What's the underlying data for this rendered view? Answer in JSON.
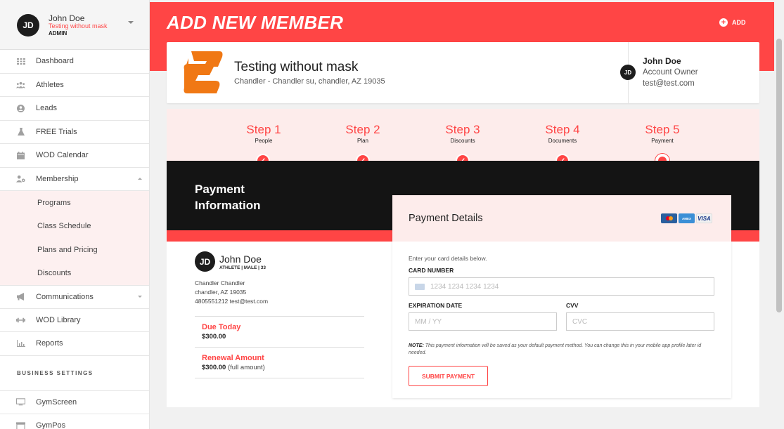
{
  "user": {
    "initials": "JD",
    "name": "John Doe",
    "subtitle": "Testing without mask",
    "role": "ADMIN"
  },
  "sidebar": {
    "items": [
      {
        "label": "Dashboard",
        "icon": "grid-icon"
      },
      {
        "label": "Athletes",
        "icon": "users-icon"
      },
      {
        "label": "Leads",
        "icon": "user-circle-icon"
      },
      {
        "label": "FREE Trials",
        "icon": "flask-icon"
      },
      {
        "label": "WOD Calendar",
        "icon": "calendar-icon"
      },
      {
        "label": "Membership",
        "icon": "user-gear-icon",
        "expanded": true
      }
    ],
    "membership_sub": [
      "Programs",
      "Class Schedule",
      "Plans and Pricing",
      "Discounts"
    ],
    "items_after": [
      {
        "label": "Communications",
        "icon": "megaphone-icon"
      },
      {
        "label": "WOD Library",
        "icon": "dumbbell-icon"
      },
      {
        "label": "Reports",
        "icon": "chart-icon"
      }
    ],
    "section_title": "BUSINESS SETTINGS",
    "settings_items": [
      {
        "label": "GymScreen",
        "icon": "monitor-icon"
      },
      {
        "label": "GymPos",
        "icon": "store-icon"
      }
    ]
  },
  "header": {
    "title": "ADD NEW MEMBER",
    "add_label": "ADD"
  },
  "gym": {
    "name": "Testing without mask",
    "address": "Chandler - Chandler su, chandler, AZ 19035",
    "owner_initials": "JD",
    "owner_name": "John Doe",
    "owner_role": "Account Owner",
    "owner_email": "test@test.com"
  },
  "steps": [
    {
      "title": "Step 1",
      "sub": "People",
      "done": true
    },
    {
      "title": "Step 2",
      "sub": "Plan",
      "done": true
    },
    {
      "title": "Step 3",
      "sub": "Discounts",
      "done": true
    },
    {
      "title": "Step 4",
      "sub": "Documents",
      "done": true
    },
    {
      "title": "Step 5",
      "sub": "Payment",
      "done": false
    }
  ],
  "payment_info": {
    "title_line1": "Payment",
    "title_line2": "Information",
    "member_initials": "JD",
    "member_name": "John Doe",
    "member_meta": "ATHLETE | MALE | 33",
    "address_line1": "Chandler Chandler",
    "address_line2": "chandler, AZ 19035",
    "contact_line": "4805551212 test@test.com",
    "due_today_label": "Due Today",
    "due_today_value": "$300.00",
    "renewal_label": "Renewal Amount",
    "renewal_value": "$300.00",
    "renewal_note": "(full amount)"
  },
  "payment_details": {
    "title": "Payment Details",
    "intro": "Enter your card details below.",
    "card_number_label": "CARD NUMBER",
    "card_number_placeholder": "1234 1234 1234 1234",
    "expiration_label": "EXPIRATION DATE",
    "expiration_placeholder": "MM / YY",
    "cvv_label": "CVV",
    "cvv_placeholder": "CVC",
    "note_bold": "NOTE:",
    "note_text": " This payment information will be saved as your default payment method. You can change this in your mobile app profile later id needed.",
    "submit_label": "SUBMIT PAYMENT",
    "card_brands": [
      "MC",
      "AMEX",
      "VISA"
    ]
  },
  "colors": {
    "accent": "#ff4545",
    "dark": "#141414",
    "soft_pink": "#fdeceb"
  }
}
